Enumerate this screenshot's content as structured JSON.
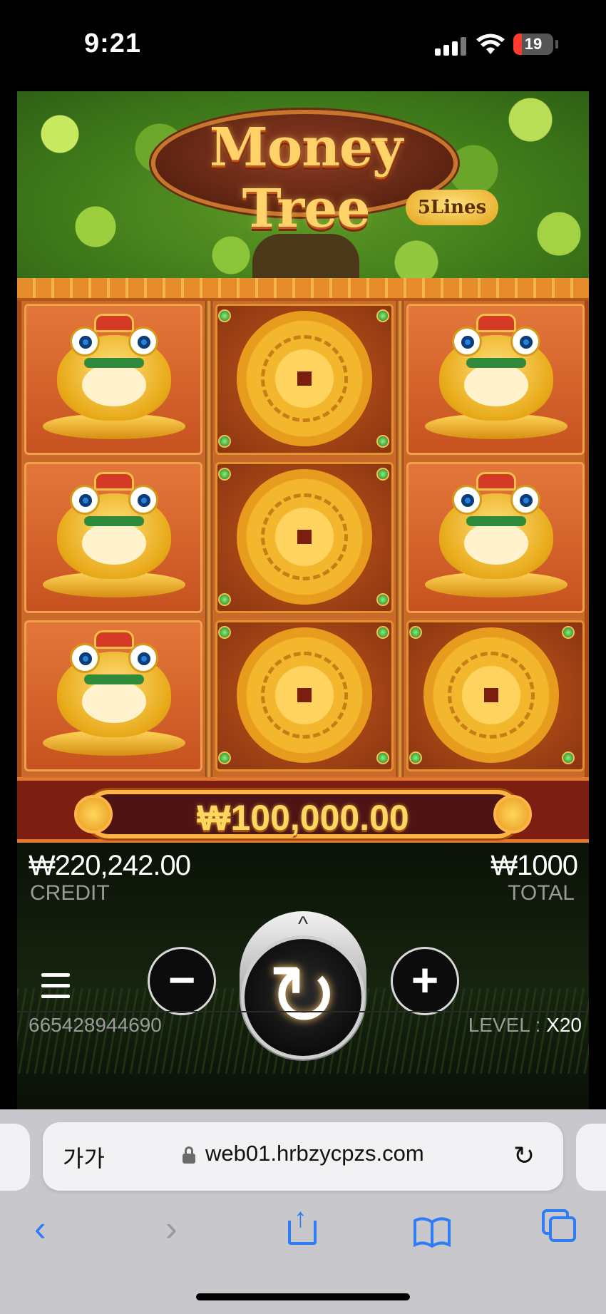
{
  "status_bar": {
    "time": "9:21",
    "battery": "19"
  },
  "game": {
    "title": "Money Tree",
    "lines_badge": "5Lines",
    "win_amount": "₩100,000.00",
    "credit": {
      "value": "₩220,242.00",
      "label": "CREDIT"
    },
    "total": {
      "value": "₩1000",
      "label": "TOTAL"
    },
    "controls": {
      "menu": "menu-icon",
      "decrease": "−",
      "spin": "↻",
      "increase": "+",
      "expand": "^"
    },
    "game_id": "665428944690",
    "level": {
      "label": "LEVEL :",
      "value": "X20"
    },
    "reels": [
      [
        "golden-toad",
        "golden-toad",
        "golden-toad"
      ],
      [
        "gold-coin",
        "gold-coin",
        "gold-coin"
      ],
      [
        "golden-toad",
        "golden-toad",
        "gold-coin"
      ]
    ]
  },
  "browser": {
    "text_size": "가가",
    "url": "web01.hrbzycpzs.com",
    "toolbar_icons": [
      "back-icon",
      "forward-icon",
      "share-icon",
      "bookmarks-icon",
      "tabs-icon"
    ]
  },
  "colors": {
    "accent_gold": "#ffd660",
    "win_panel": "#4e1414",
    "safari_blue": "#2e7cf6"
  }
}
